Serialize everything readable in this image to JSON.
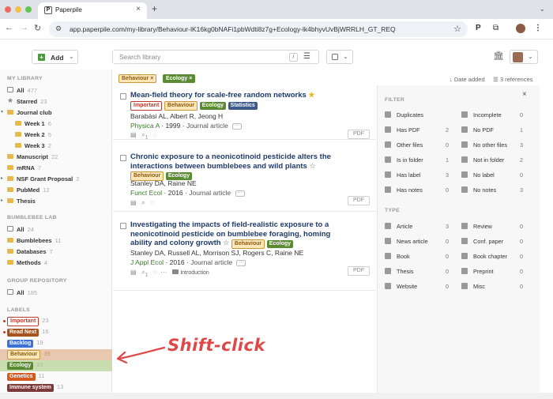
{
  "browser": {
    "tab_title": "Paperpile",
    "favicon_letter": "P",
    "url": "app.paperpile.com/my-library/Behaviour-lK16kg0bNAFi1pbWdti8z7g+Ecology-lk4bhyvUvBjWRRLH_GT_REQ"
  },
  "toolbar": {
    "add_label": "Add",
    "search_placeholder": "Search library",
    "search_shortcut": "/"
  },
  "sidebar": {
    "my_library_title": "MY LIBRARY",
    "my_library": [
      {
        "label": "All",
        "count": "477"
      },
      {
        "label": "Starred",
        "count": "23"
      },
      {
        "label": "Journal club",
        "count": ""
      },
      {
        "label": "Week 1",
        "count": "6"
      },
      {
        "label": "Week 2",
        "count": "5"
      },
      {
        "label": "Week 3",
        "count": "2"
      },
      {
        "label": "Manuscript",
        "count": "22"
      },
      {
        "label": "mRNA",
        "count": "7"
      },
      {
        "label": "NSF Grant Proposal",
        "count": "2"
      },
      {
        "label": "PubMed",
        "count": "12"
      },
      {
        "label": "Thesis",
        "count": ""
      }
    ],
    "bumblebee_title": "BUMBLEBEE LAB",
    "bumblebee": [
      {
        "label": "All",
        "count": "24"
      },
      {
        "label": "Bumblebees",
        "count": "11"
      },
      {
        "label": "Databases",
        "count": "7"
      },
      {
        "label": "Methods",
        "count": "4"
      }
    ],
    "group_title": "GROUP REPOSITORY",
    "group": [
      {
        "label": "All",
        "count": "185"
      }
    ],
    "labels_title": "LABELS",
    "labels": [
      {
        "label": "Important",
        "count": "23"
      },
      {
        "label": "Read Next",
        "count": "16"
      },
      {
        "label": "Backlog",
        "count": "19"
      },
      {
        "label": "Behaviour",
        "count": "39"
      },
      {
        "label": "Ecology",
        "count": "33"
      },
      {
        "label": "Genetics",
        "count": "11"
      },
      {
        "label": "Immune system",
        "count": "13"
      }
    ]
  },
  "active_filters": [
    "Behaviour",
    "Ecology"
  ],
  "sort": {
    "label": "Date added",
    "references": "3 references"
  },
  "papers": [
    {
      "title": "Mean-field theory for scale-free random networks",
      "labels": [
        "Important",
        "Behaviour",
        "Ecology",
        "Statistics"
      ],
      "authors": "Barabási AL, Albert R, Jeong H",
      "journal": "Physica A",
      "year": "1999",
      "type": "Journal article",
      "attach_count": "1",
      "pdf": "PDF"
    },
    {
      "title": "Chronic exposure to a neonicotinoid pesticide alters the interactions between bumblebees and wild plants",
      "labels": [
        "Behaviour",
        "Ecology"
      ],
      "authors": "Stanley DA, Raine NE",
      "journal": "Funct Ecol",
      "year": "2016",
      "type": "Journal article",
      "pdf": "PDF"
    },
    {
      "title": "Investigating the impacts of field-realistic exposure to a neonicotinoid pesticide on bumblebee foraging, homing ability and colony growth",
      "labels": [
        "Behaviour",
        "Ecology"
      ],
      "authors": "Stanley DA, Russell AL, Morrison SJ, Rogers C, Raine NE",
      "journal": "J Appl Ecol",
      "year": "2016",
      "type": "Journal article",
      "attach_count": "1",
      "folder": "Introduction",
      "pdf": "PDF"
    }
  ],
  "filter_panel": {
    "filter_title": "FILTER",
    "filter_rows": [
      {
        "left": "Duplicates",
        "left_n": "",
        "right": "Incomplete",
        "right_n": "0"
      },
      {
        "left": "Has PDF",
        "left_n": "2",
        "right": "No PDF",
        "right_n": "1"
      },
      {
        "left": "Other files",
        "left_n": "0",
        "right": "No other files",
        "right_n": "3"
      },
      {
        "left": "Is in folder",
        "left_n": "1",
        "right": "Not in folder",
        "right_n": "2"
      },
      {
        "left": "Has label",
        "left_n": "3",
        "right": "No label",
        "right_n": "0"
      },
      {
        "left": "Has notes",
        "left_n": "0",
        "right": "No notes",
        "right_n": "3"
      }
    ],
    "type_title": "TYPE",
    "type_rows": [
      {
        "left": "Article",
        "left_n": "3",
        "right": "Review",
        "right_n": "0"
      },
      {
        "left": "News article",
        "left_n": "0",
        "right": "Conf. paper",
        "right_n": "0"
      },
      {
        "left": "Book",
        "left_n": "0",
        "right": "Book chapter",
        "right_n": "0"
      },
      {
        "left": "Thesis",
        "left_n": "0",
        "right": "Preprint",
        "right_n": "0"
      },
      {
        "left": "Website",
        "left_n": "0",
        "right": "Misc",
        "right_n": "0"
      }
    ]
  },
  "annotation": "Shift-click",
  "colors": {
    "important": "#c0392b",
    "read_next": "#a6531f",
    "backlog": "#3d70d4",
    "behaviour": "#fde7b8",
    "ecology": "#5a8a32",
    "genetics": "#d45a22",
    "immune": "#7a3a3a",
    "annotation": "#e04848"
  }
}
